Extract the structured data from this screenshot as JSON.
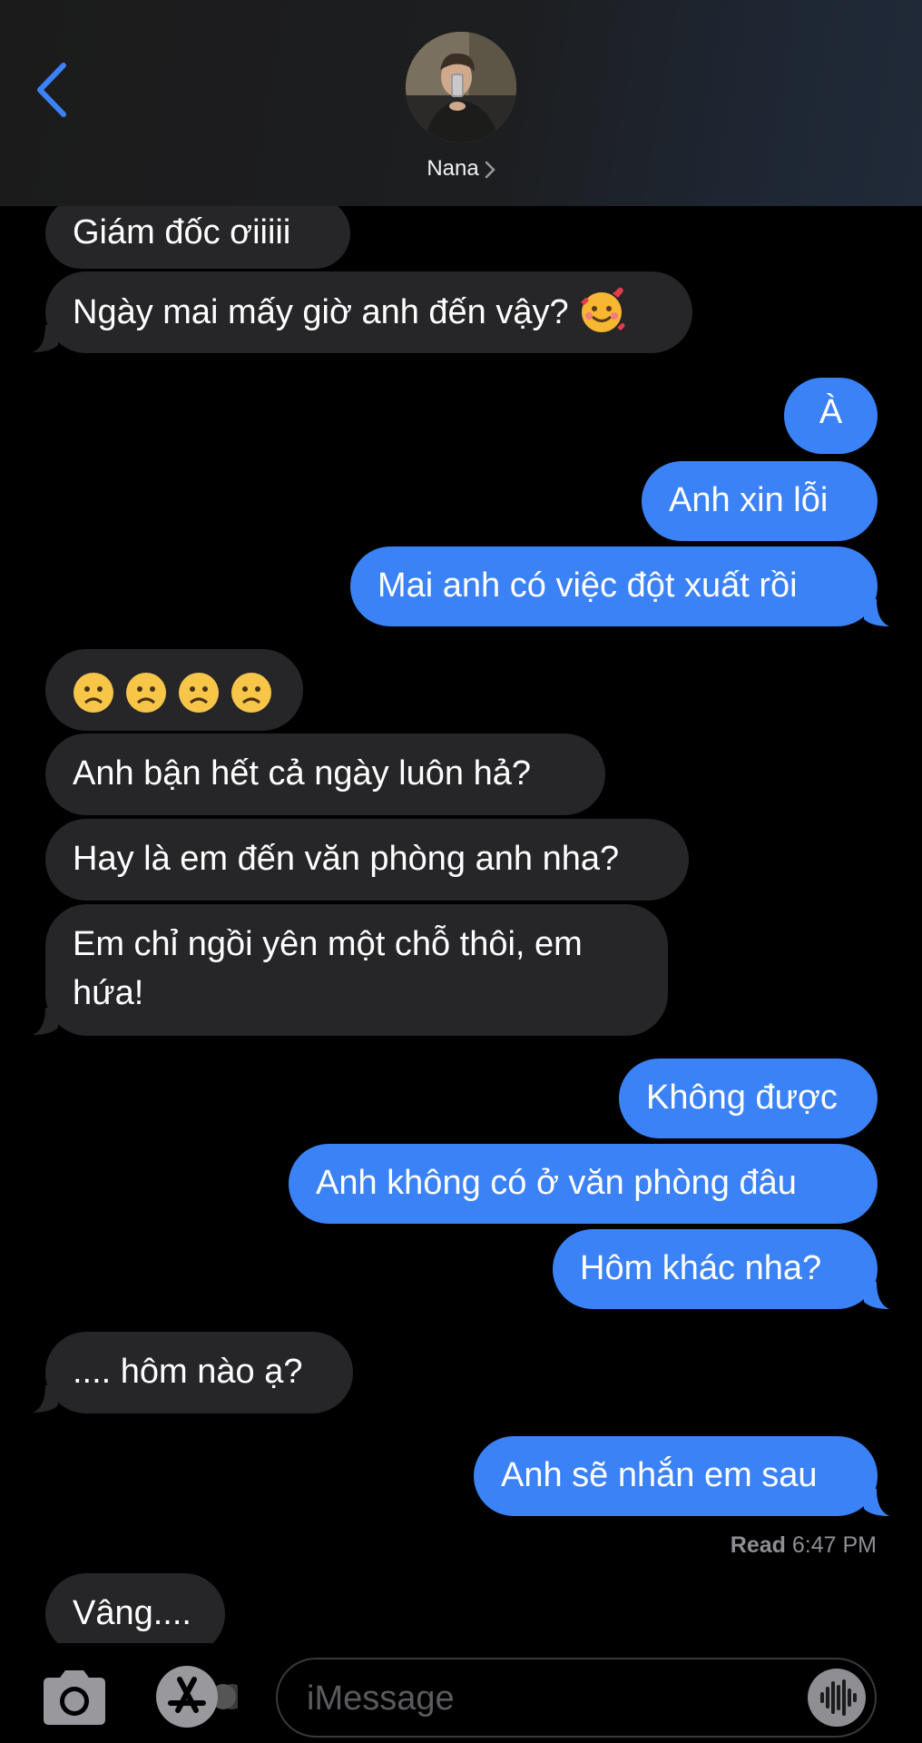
{
  "header": {
    "contact_name": "Nana",
    "back_icon": "chevron-left-icon"
  },
  "messages": [
    {
      "from": "them",
      "text": "Giám đốc ơiiiii"
    },
    {
      "from": "them",
      "text": "Ngày mai mấy giờ anh đến vậy? 🥰"
    },
    {
      "from": "me",
      "text": "À"
    },
    {
      "from": "me",
      "text": "Anh xin lỗi"
    },
    {
      "from": "me",
      "text": "Mai anh có việc đột xuất rồi"
    },
    {
      "from": "them",
      "text": "☹☹☹☹"
    },
    {
      "from": "them",
      "text": "Anh bận hết cả ngày luôn hả?"
    },
    {
      "from": "them",
      "text": "Hay là em đến văn phòng anh nha?"
    },
    {
      "from": "them",
      "text": "Em chỉ ngồi yên một chỗ thôi, em hứa!"
    },
    {
      "from": "me",
      "text": "Không được"
    },
    {
      "from": "me",
      "text": "Anh không có ở văn phòng đâu"
    },
    {
      "from": "me",
      "text": "Hôm khác nha?"
    },
    {
      "from": "them",
      "text": ".... hôm nào ạ?"
    },
    {
      "from": "me",
      "text": "Anh sẽ nhắn em sau"
    },
    {
      "from": "them",
      "text": "Vâng...."
    }
  ],
  "read_receipt": {
    "label": "Read",
    "time": "6:47 PM"
  },
  "input": {
    "placeholder": "iMessage"
  },
  "colors": {
    "outgoing": "#3b82f6",
    "incoming": "#262628",
    "accent": "#3b82f6"
  }
}
